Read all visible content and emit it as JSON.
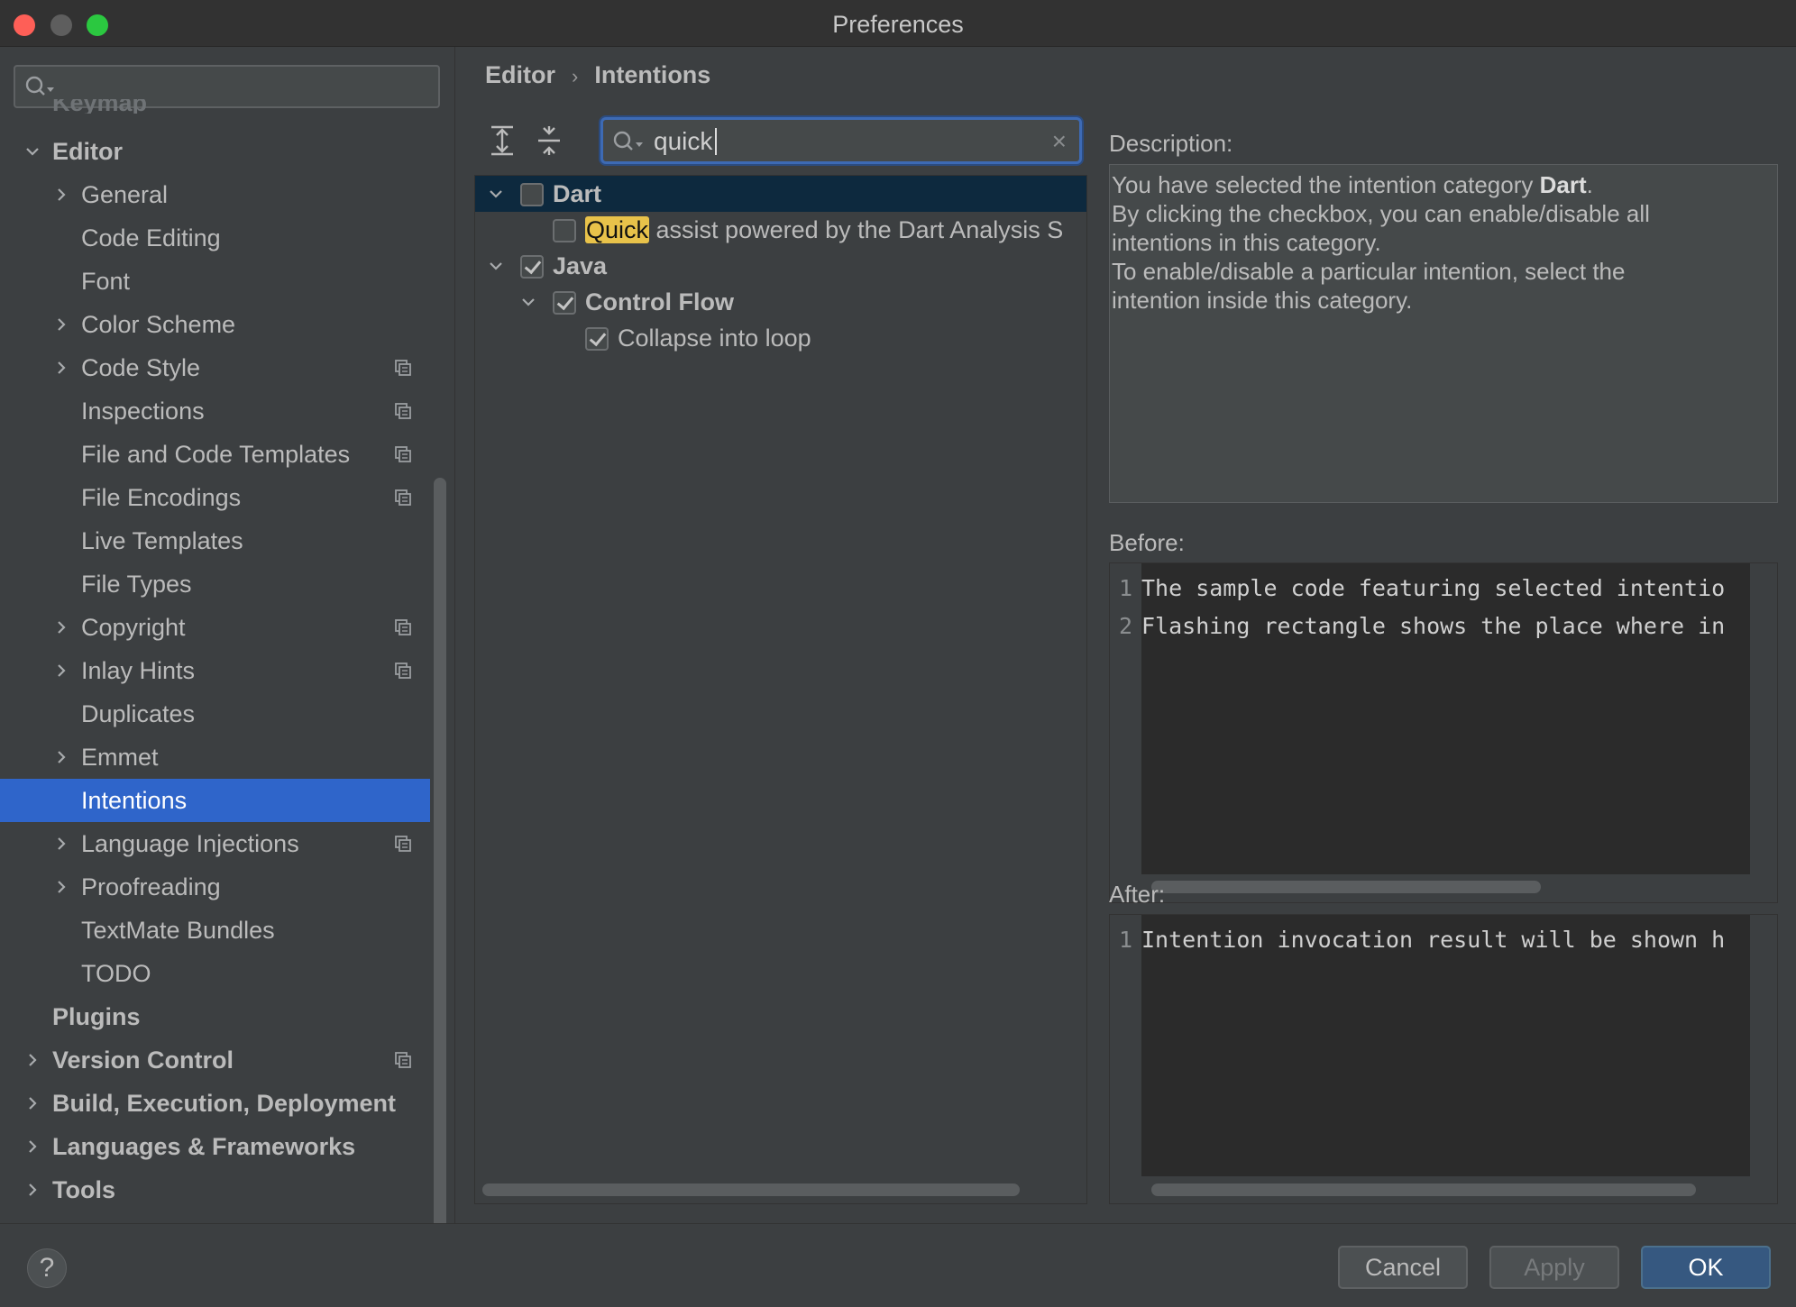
{
  "window": {
    "title": "Preferences"
  },
  "sidebar": {
    "search_placeholder": "",
    "cut_item": "Keymap",
    "items": [
      {
        "label": "Editor",
        "level": 0,
        "expanded": true,
        "bold": true,
        "copy": false
      },
      {
        "label": "General",
        "level": 1,
        "chevron": true,
        "copy": false
      },
      {
        "label": "Code Editing",
        "level": 1,
        "copy": false
      },
      {
        "label": "Font",
        "level": 1,
        "copy": false
      },
      {
        "label": "Color Scheme",
        "level": 1,
        "chevron": true,
        "copy": false
      },
      {
        "label": "Code Style",
        "level": 1,
        "chevron": true,
        "copy": true
      },
      {
        "label": "Inspections",
        "level": 1,
        "copy": true
      },
      {
        "label": "File and Code Templates",
        "level": 1,
        "copy": true
      },
      {
        "label": "File Encodings",
        "level": 1,
        "copy": true
      },
      {
        "label": "Live Templates",
        "level": 1,
        "copy": false
      },
      {
        "label": "File Types",
        "level": 1,
        "copy": false
      },
      {
        "label": "Copyright",
        "level": 1,
        "chevron": true,
        "copy": true
      },
      {
        "label": "Inlay Hints",
        "level": 1,
        "chevron": true,
        "copy": true
      },
      {
        "label": "Duplicates",
        "level": 1,
        "copy": false
      },
      {
        "label": "Emmet",
        "level": 1,
        "chevron": true,
        "copy": false
      },
      {
        "label": "Intentions",
        "level": 1,
        "selected": true,
        "copy": false
      },
      {
        "label": "Language Injections",
        "level": 1,
        "chevron": true,
        "copy": true
      },
      {
        "label": "Proofreading",
        "level": 1,
        "chevron": true,
        "copy": false
      },
      {
        "label": "TextMate Bundles",
        "level": 1,
        "copy": false
      },
      {
        "label": "TODO",
        "level": 1,
        "copy": false
      },
      {
        "label": "Plugins",
        "level": 0,
        "bold": true,
        "copy": false
      },
      {
        "label": "Version Control",
        "level": 0,
        "chevron": true,
        "bold": true,
        "copy": true
      },
      {
        "label": "Build, Execution, Deployment",
        "level": 0,
        "chevron": true,
        "bold": true,
        "copy": false
      },
      {
        "label": "Languages & Frameworks",
        "level": 0,
        "chevron": true,
        "bold": true,
        "copy": false
      },
      {
        "label": "Tools",
        "level": 0,
        "chevron": true,
        "bold": true,
        "copy": false
      }
    ]
  },
  "breadcrumb": {
    "parent": "Editor",
    "separator": "›",
    "current": "Intentions"
  },
  "search": {
    "value": "quick",
    "clear_icon": "×"
  },
  "intentions_tree": [
    {
      "label": "Dart",
      "level": 0,
      "expanded": true,
      "checked": false,
      "bold": true,
      "highlighted": true
    },
    {
      "match": "Quick",
      "rest": " assist powered by the Dart Analysis S",
      "level": 1,
      "checked": false
    },
    {
      "label": "Java",
      "level": 0,
      "expanded": true,
      "checked": true,
      "bold": true
    },
    {
      "label": "Control Flow",
      "level": 1,
      "expanded": true,
      "checked": true,
      "bold": true
    },
    {
      "label": "Collapse into loop",
      "level": 2,
      "checked": true
    }
  ],
  "description": {
    "label": "Description:",
    "line1_prefix": "You have selected the intention category ",
    "line1_bold": "Dart",
    "line1_suffix": ".",
    "line2": "By clicking the checkbox, you can enable/disable all",
    "line3": "intentions in this category.",
    "line4": "To enable/disable a particular intention, select the",
    "line5": "intention inside this category."
  },
  "before": {
    "label": "Before:",
    "lines": [
      {
        "num": "1",
        "text": "The sample code featuring selected intentio"
      },
      {
        "num": "2",
        "text": "Flashing rectangle shows the place where in"
      }
    ]
  },
  "after": {
    "label": "After:",
    "lines": [
      {
        "num": "1",
        "text": "Intention invocation result will be shown h"
      }
    ]
  },
  "buttons": {
    "help": "?",
    "cancel": "Cancel",
    "apply": "Apply",
    "ok": "OK"
  },
  "colors": {
    "selection": "#2f65ca",
    "accent": "#365880",
    "match": "#e8c24a",
    "tree_highlight": "#0d293e"
  }
}
